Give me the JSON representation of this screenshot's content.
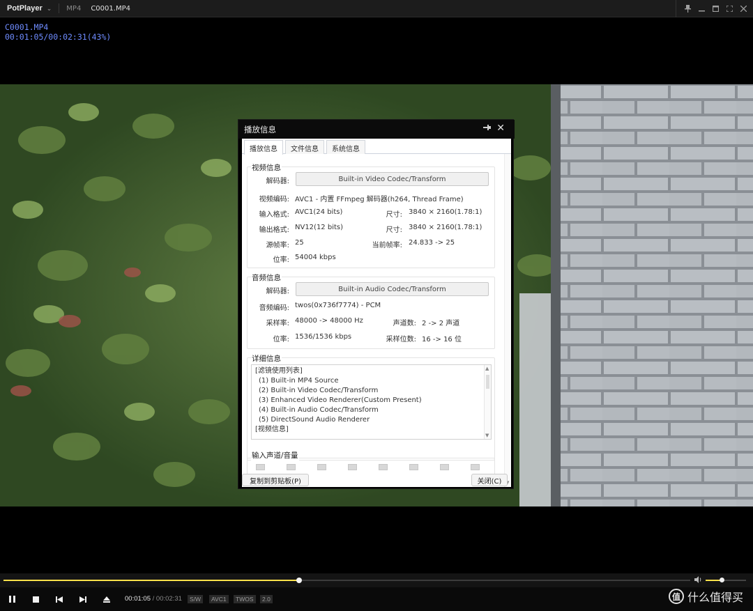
{
  "titlebar": {
    "app_name": "PotPlayer",
    "format": "MP4",
    "file": "C0001.MP4"
  },
  "osd": {
    "filename": "C0001.MP4",
    "position": "00:01:05/00:02:31(43%)"
  },
  "dialog": {
    "title": "播放信息",
    "tabs": [
      "播放信息",
      "文件信息",
      "系统信息"
    ],
    "video_group": {
      "label": "视频信息",
      "decoder_label": "解码器:",
      "decoder_button": "Built-in Video Codec/Transform",
      "codec_label": "视频编码:",
      "codec_value": "AVC1 - 内置 FFmpeg 解码器(h264, Thread Frame)",
      "input_format_label": "输入格式:",
      "input_format_value": "AVC1(24 bits)",
      "input_size_label": "尺寸:",
      "input_size_value": "3840 × 2160(1.78:1)",
      "output_format_label": "输出格式:",
      "output_format_value": "NV12(12 bits)",
      "output_size_label": "尺寸:",
      "output_size_value": "3840 × 2160(1.78:1)",
      "source_fps_label": "源帧率:",
      "source_fps_value": "25",
      "current_fps_label": "当前帧率:",
      "current_fps_value": "24.833 -> 25",
      "bitrate_label": "位率:",
      "bitrate_value": "54004 kbps"
    },
    "audio_group": {
      "label": "音频信息",
      "decoder_label": "解码器:",
      "decoder_button": "Built-in Audio Codec/Transform",
      "codec_label": "音频编码:",
      "codec_value": "twos(0x736f7774) - PCM",
      "samplerate_label": "采样率:",
      "samplerate_value": "48000 -> 48000 Hz",
      "channels_label": "声道数:",
      "channels_value": "2 -> 2 声道",
      "bitrate_label": "位率:",
      "bitrate_value": "1536/1536 kbps",
      "bitdepth_label": "采样位数:",
      "bitdepth_value": "16 -> 16 位"
    },
    "detail_group": {
      "label": "详细信息",
      "lines": [
        "[滤镜使用列表]",
        "(1) Built-in MP4 Source",
        "(2) Built-in Video Codec/Transform",
        "(3) Enhanced Video Renderer(Custom Present)",
        "(4) Built-in Audio Codec/Transform",
        "(5) DirectSound Audio Renderer",
        "",
        "[视频信息]"
      ]
    },
    "channel_group": {
      "label": "输入声道/音量"
    },
    "copy_button": "复制到剪贴板(P)",
    "close_button": "关闭(C)"
  },
  "seek": {
    "progress": 0.43,
    "volume": 0.4
  },
  "controls": {
    "time_current": "00:01:05",
    "time_separator": "/",
    "time_total": "00:02:31",
    "badges": [
      "S/W",
      "AVC1",
      "TWOS",
      "2.0"
    ]
  },
  "watermark": {
    "logo": "值",
    "text": "什么值得买"
  },
  "colors": {
    "accent": "#ffe24a",
    "osd_text": "#6f8cff",
    "titlebar_bg": "#1c1c1c"
  }
}
